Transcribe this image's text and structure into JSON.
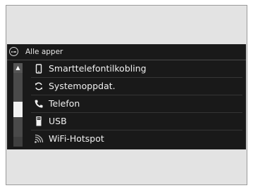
{
  "header": {
    "menu_icon": "apps-menu-icon",
    "title": "Alle apper"
  },
  "scrollbar": {
    "up_icon": "arrow-up-icon",
    "position_fraction": 0.6
  },
  "apps": [
    {
      "label": "Smarttelefontilkobling",
      "icon": "smartphone-icon"
    },
    {
      "label": "Systemoppdat.",
      "icon": "refresh-icon"
    },
    {
      "label": "Telefon",
      "icon": "phone-handset-icon"
    },
    {
      "label": "USB",
      "icon": "usb-icon"
    },
    {
      "label": "WiFi-Hotspot",
      "icon": "wifi-hotspot-icon"
    }
  ],
  "colors": {
    "screen_background": "#191919",
    "text": "#f0f0f0",
    "scrollbar_track": "#4a4a4a",
    "scrollbar_thumb": "#f2f2f2"
  }
}
